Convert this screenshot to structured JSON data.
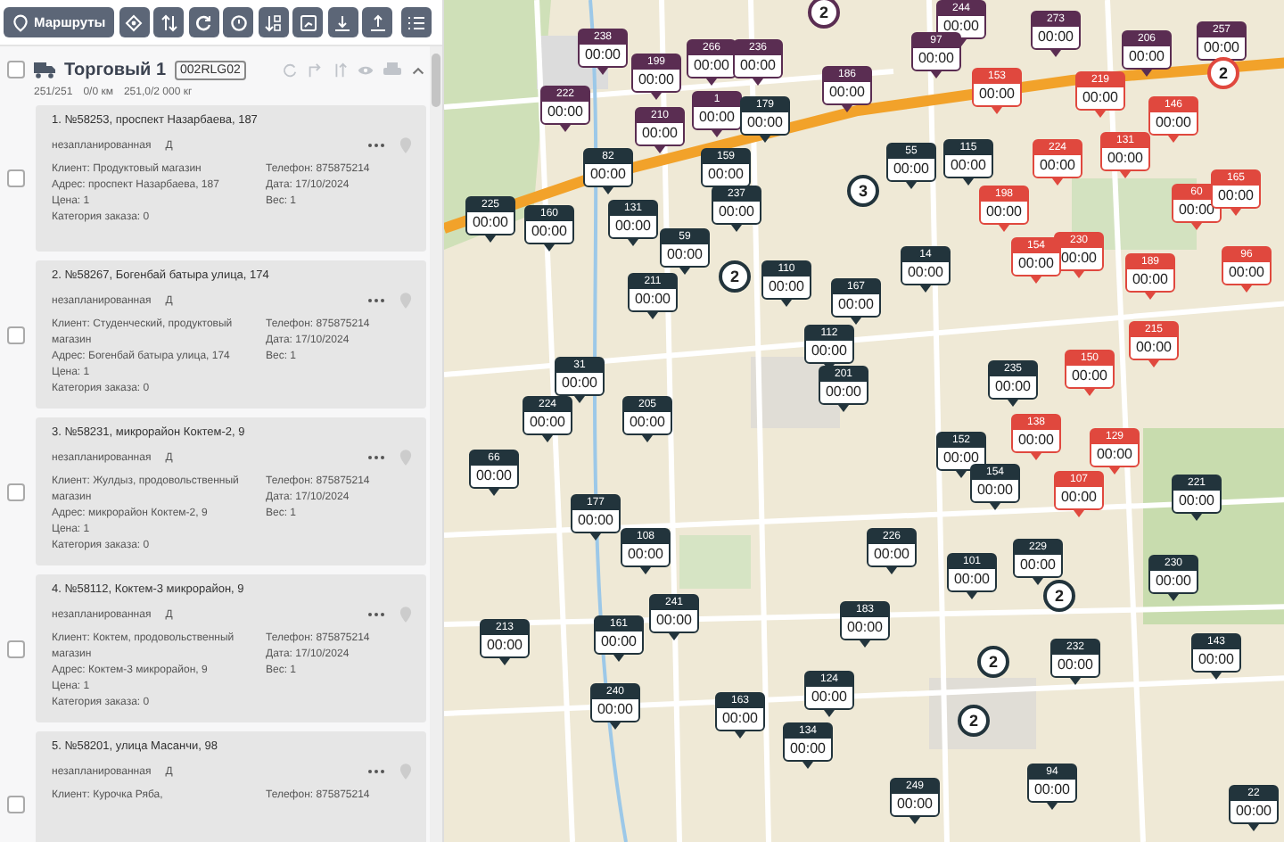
{
  "toolbar": {
    "routes_button": "Маршруты"
  },
  "route": {
    "name": "Торговый 1",
    "code": "002RLG02",
    "checked": false,
    "expanded": true,
    "stats": [
      "251/251",
      "0/0 км",
      "251,0/2 000 кг"
    ]
  },
  "orders": [
    {
      "title": "1. №58253, проспект Назарбаева, 187",
      "status": "незапланированная",
      "tag": "Д",
      "checked": false,
      "left": [
        "Клиент: Продуктовый магазин",
        "Адрес: проспект Назарбаева, 187",
        "Цена: 1",
        "Категория заказа: 0"
      ],
      "right": [
        "Телефон: 875875214",
        "Дата: 17/10/2024",
        "Вес: 1"
      ]
    },
    {
      "title": "2. №58267, Богенбай батыра улица, 174",
      "status": "незапланированная",
      "tag": "Д",
      "checked": false,
      "left": [
        "Клиент: Студенческий, продуктовый магазин",
        "Адрес: Богенбай батыра улица, 174",
        "Цена: 1",
        "Категория заказа: 0"
      ],
      "right": [
        "Телефон: 875875214",
        "Дата: 17/10/2024",
        "Вес: 1"
      ]
    },
    {
      "title": "3. №58231, микрорайон Коктем-2, 9",
      "status": "незапланированная",
      "tag": "Д",
      "checked": false,
      "left": [
        "Клиент: Жулдыз, продовольственный магазин",
        "Адрес: микрорайон Коктем-2, 9",
        "Цена: 1",
        "Категория заказа: 0"
      ],
      "right": [
        "Телефон: 875875214",
        "Дата: 17/10/2024",
        "Вес: 1"
      ]
    },
    {
      "title": "4. №58112, Коктем-3 микрорайон, 9",
      "status": "незапланированная",
      "tag": "Д",
      "checked": false,
      "left": [
        "Клиент: Коктем, продовольственный магазин",
        "Адрес: Коктем-3 микрорайон, 9",
        "Цена: 1",
        "Категория заказа: 0"
      ],
      "right": [
        "Телефон: 875875214",
        "Дата: 17/10/2024",
        "Вес: 1"
      ]
    },
    {
      "title": "5. №58201, улица Масанчи, 98",
      "status": "незапланированная",
      "tag": "Д",
      "checked": false,
      "left": [
        "Клиент: Курочка Ряба,"
      ],
      "right": [
        "Телефон: 875875214"
      ]
    }
  ],
  "map": {
    "markers": [
      {
        "number": "238",
        "time": "00:00",
        "color": "#5a2d52"
      },
      {
        "number": "222",
        "time": "00:00",
        "color": "#5a2d52"
      },
      {
        "number": "199",
        "time": "00:00",
        "color": "#5a2d52"
      },
      {
        "number": "210",
        "time": "00:00",
        "color": "#5a2d52"
      },
      {
        "number": "266",
        "time": "00:00",
        "color": "#5a2d52"
      },
      {
        "number": "236",
        "time": "00:00",
        "color": "#5a2d52"
      },
      {
        "number": "1",
        "time": "00:00",
        "color": "#5a2d52"
      },
      {
        "number": "186",
        "time": "00:00",
        "color": "#5a2d52"
      },
      {
        "number": "244",
        "time": "00:00",
        "color": "#5a2d52"
      },
      {
        "number": "97",
        "time": "00:00",
        "color": "#5a2d52"
      },
      {
        "number": "273",
        "time": "00:00",
        "color": "#5a2d52"
      },
      {
        "number": "206",
        "time": "00:00",
        "color": "#5a2d52"
      },
      {
        "number": "257",
        "time": "00:00",
        "color": "#5a2d52"
      },
      {
        "number": "179",
        "time": "00:00",
        "color": "#22343c"
      },
      {
        "number": "82",
        "time": "00:00",
        "color": "#22343c"
      },
      {
        "number": "159",
        "time": "00:00",
        "color": "#22343c"
      },
      {
        "number": "225",
        "time": "00:00",
        "color": "#22343c"
      },
      {
        "number": "160",
        "time": "00:00",
        "color": "#22343c"
      },
      {
        "number": "131",
        "time": "00:00",
        "color": "#22343c"
      },
      {
        "number": "59",
        "time": "00:00",
        "color": "#22343c"
      },
      {
        "number": "237",
        "time": "00:00",
        "color": "#22343c"
      },
      {
        "number": "55",
        "time": "00:00",
        "color": "#22343c"
      },
      {
        "number": "115",
        "time": "00:00",
        "color": "#22343c"
      },
      {
        "number": "14",
        "time": "00:00",
        "color": "#22343c"
      },
      {
        "number": "211",
        "time": "00:00",
        "color": "#22343c"
      },
      {
        "number": "110",
        "time": "00:00",
        "color": "#22343c"
      },
      {
        "number": "167",
        "time": "00:00",
        "color": "#22343c"
      },
      {
        "number": "112",
        "time": "00:00",
        "color": "#22343c"
      },
      {
        "number": "31",
        "time": "00:00",
        "color": "#22343c"
      },
      {
        "number": "224",
        "time": "00:00",
        "color": "#22343c"
      },
      {
        "number": "205",
        "time": "00:00",
        "color": "#22343c"
      },
      {
        "number": "201",
        "time": "00:00",
        "color": "#22343c"
      },
      {
        "number": "235",
        "time": "00:00",
        "color": "#22343c"
      },
      {
        "number": "152",
        "time": "00:00",
        "color": "#22343c"
      },
      {
        "number": "154",
        "time": "00:00",
        "color": "#22343c"
      },
      {
        "number": "221",
        "time": "00:00",
        "color": "#22343c"
      },
      {
        "number": "229",
        "time": "00:00",
        "color": "#22343c"
      },
      {
        "number": "230",
        "time": "00:00",
        "color": "#22343c"
      },
      {
        "number": "143",
        "time": "00:00",
        "color": "#22343c"
      },
      {
        "number": "124",
        "time": "00:00",
        "color": "#22343c"
      },
      {
        "number": "163",
        "time": "00:00",
        "color": "#22343c"
      },
      {
        "number": "134",
        "time": "00:00",
        "color": "#22343c"
      },
      {
        "number": "249",
        "time": "00:00",
        "color": "#22343c"
      },
      {
        "number": "94",
        "time": "00:00",
        "color": "#22343c"
      },
      {
        "number": "66",
        "time": "00:00",
        "color": "#22343c"
      },
      {
        "number": "177",
        "time": "00:00",
        "color": "#22343c"
      },
      {
        "number": "108",
        "time": "00:00",
        "color": "#22343c"
      },
      {
        "number": "241",
        "time": "00:00",
        "color": "#22343c"
      },
      {
        "number": "232",
        "time": "00:00",
        "color": "#22343c"
      },
      {
        "number": "153",
        "time": "00:00",
        "color": "#e0483e"
      },
      {
        "number": "219",
        "time": "00:00",
        "color": "#e0483e"
      },
      {
        "number": "146",
        "time": "00:00",
        "color": "#e0483e"
      },
      {
        "number": "198",
        "time": "00:00",
        "color": "#e0483e"
      },
      {
        "number": "224",
        "time": "00:00",
        "color": "#e0483e"
      },
      {
        "number": "131",
        "time": "00:00",
        "color": "#e0483e"
      },
      {
        "number": "60",
        "time": "00:00",
        "color": "#e0483e"
      },
      {
        "number": "165",
        "time": "00:00",
        "color": "#e0483e"
      },
      {
        "number": "230",
        "time": "00:00",
        "color": "#e0483e"
      },
      {
        "number": "154",
        "time": "00:00",
        "color": "#e0483e"
      },
      {
        "number": "96",
        "time": "00:00",
        "color": "#e0483e"
      },
      {
        "number": "189",
        "time": "00:00",
        "color": "#e0483e"
      },
      {
        "number": "150",
        "time": "00:00",
        "color": "#e0483e"
      },
      {
        "number": "215",
        "time": "00:00",
        "color": "#e0483e"
      },
      {
        "number": "138",
        "time": "00:00",
        "color": "#e0483e"
      },
      {
        "number": "129",
        "time": "00:00",
        "color": "#e0483e"
      },
      {
        "number": "107",
        "time": "00:00",
        "color": "#e0483e"
      },
      {
        "number": "213",
        "time": "00:00",
        "color": "#22343c"
      },
      {
        "number": "161",
        "time": "00:00",
        "color": "#22343c"
      },
      {
        "number": "240",
        "time": "00:00",
        "color": "#22343c"
      },
      {
        "number": "183",
        "time": "00:00",
        "color": "#22343c"
      },
      {
        "number": "226",
        "time": "00:00",
        "color": "#22343c"
      },
      {
        "number": "101",
        "time": "00:00",
        "color": "#22343c"
      },
      {
        "number": "22",
        "time": "00:00",
        "color": "#22343c"
      }
    ],
    "clusters": [
      {
        "count": "2",
        "color": "#5a2d52"
      },
      {
        "count": "2",
        "color": "#e0483e"
      },
      {
        "count": "3",
        "color": "#22343c"
      },
      {
        "count": "2",
        "color": "#22343c"
      },
      {
        "count": "2",
        "color": "#22343c"
      },
      {
        "count": "2",
        "color": "#22343c"
      },
      {
        "count": "2",
        "color": "#22343c"
      }
    ]
  }
}
